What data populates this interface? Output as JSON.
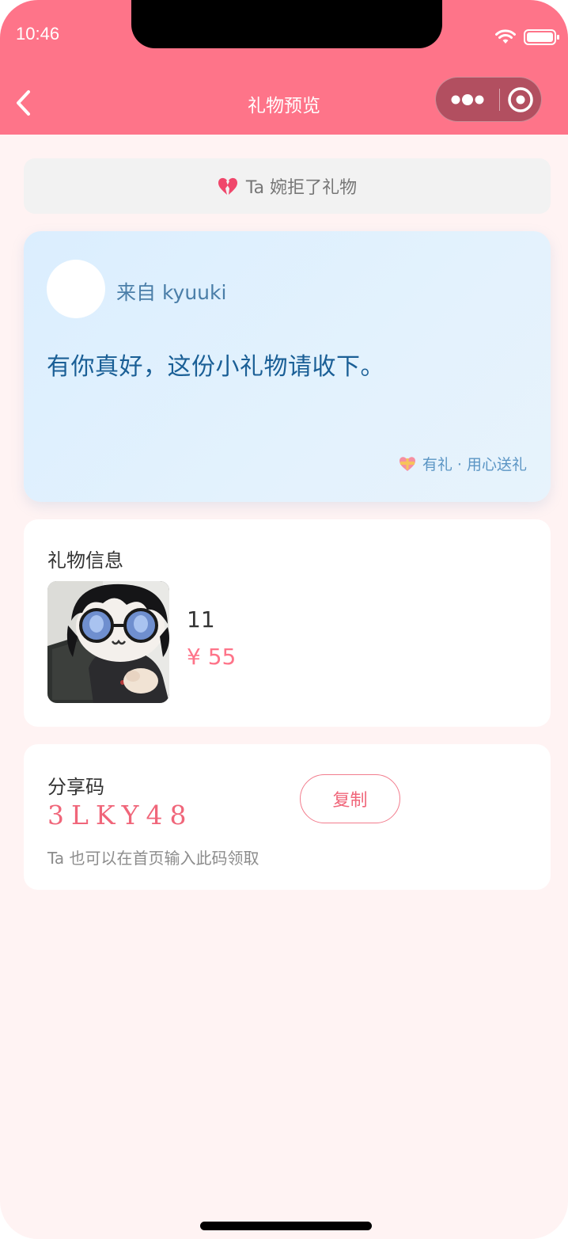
{
  "status_bar": {
    "time": "10:46",
    "icons": [
      "wifi-icon",
      "battery-icon"
    ]
  },
  "nav": {
    "title": "礼物预览",
    "back_icon": "back-chevron-icon",
    "more_icon": "more-dots-icon",
    "close_icon": "target-close-icon"
  },
  "status_banner": {
    "icon": "broken-heart-icon",
    "text": "Ta 婉拒了礼物"
  },
  "message_card": {
    "from": "来自 kyuuki",
    "message": "有你真好，这份小礼物请收下。",
    "brand": "有礼 · 用心送礼",
    "brand_icon": "gift-heart-icon"
  },
  "gift_info": {
    "title": "礼物信息",
    "name": "11",
    "price": "¥ 55",
    "image": "plush-doll-with-glasses-photo"
  },
  "share": {
    "title": "分享码",
    "code": "3LKY48",
    "copy_label": "复制",
    "hint": "Ta 也可以在首页输入此码领取"
  },
  "colors": {
    "brand_pink": "#fe7489",
    "banner_bg": "#f2f2f2",
    "message_text": "#1a5f96",
    "page_bg": "#fff3f3"
  }
}
